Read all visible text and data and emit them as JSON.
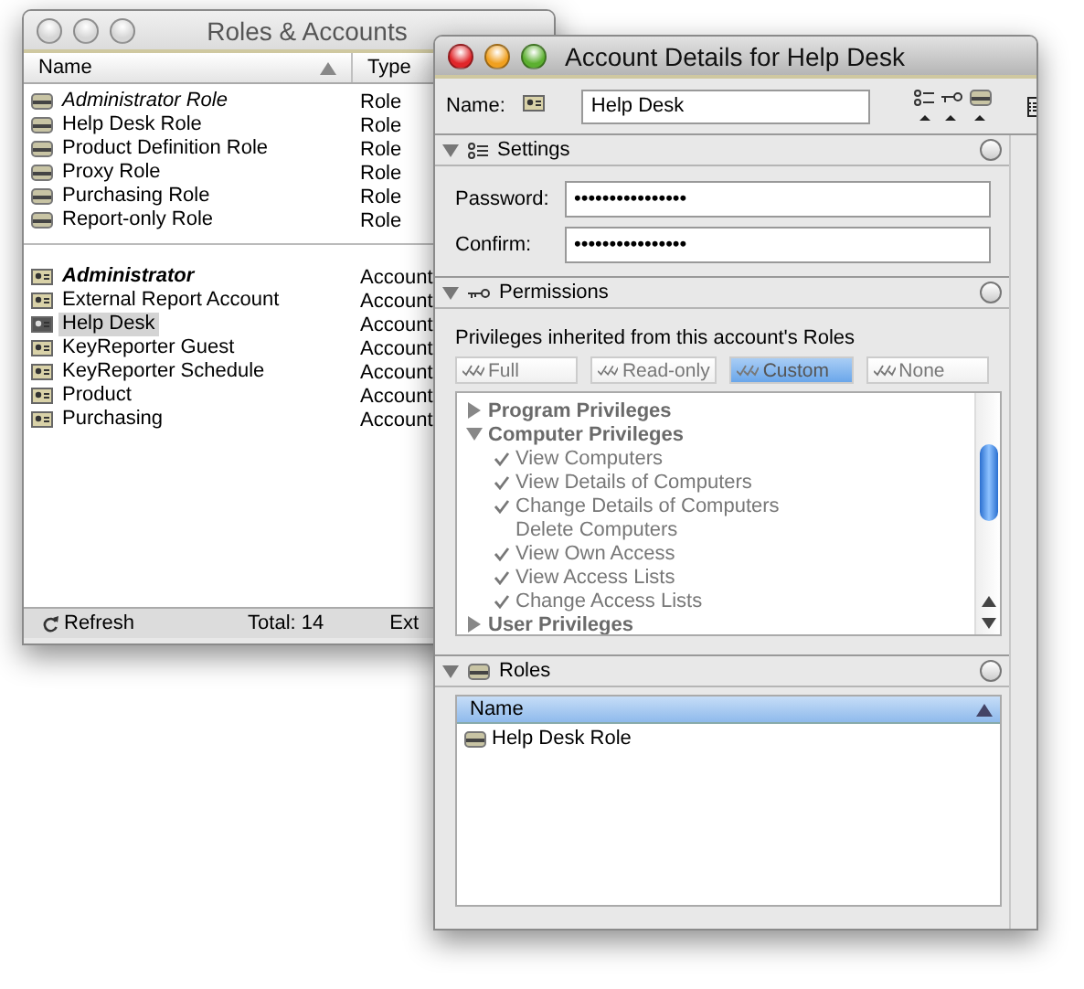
{
  "roles_window": {
    "title": "Roles & Accounts",
    "columns": [
      {
        "label": "Name",
        "sorted": true
      },
      {
        "label": "Type",
        "sorted": false
      }
    ],
    "groups": [
      [
        {
          "name": "Administrator Role",
          "type": "Role",
          "kind": "role",
          "italic": true,
          "bold": false,
          "selected": false
        },
        {
          "name": "Help Desk Role",
          "type": "Role",
          "kind": "role",
          "italic": false,
          "bold": false,
          "selected": false
        },
        {
          "name": "Product Definition Role",
          "type": "Role",
          "kind": "role",
          "italic": false,
          "bold": false,
          "selected": false
        },
        {
          "name": "Proxy Role",
          "type": "Role",
          "kind": "role",
          "italic": false,
          "bold": false,
          "selected": false
        },
        {
          "name": "Purchasing Role",
          "type": "Role",
          "kind": "role",
          "italic": false,
          "bold": false,
          "selected": false
        },
        {
          "name": "Report-only Role",
          "type": "Role",
          "kind": "role",
          "italic": false,
          "bold": false,
          "selected": false
        }
      ],
      [
        {
          "name": "Administrator",
          "type": "Account",
          "kind": "account",
          "italic": true,
          "bold": true,
          "selected": false
        },
        {
          "name": "External Report Account",
          "type": "Account",
          "kind": "account",
          "italic": false,
          "bold": false,
          "selected": false
        },
        {
          "name": "Help Desk",
          "type": "Account",
          "kind": "account",
          "italic": false,
          "bold": false,
          "selected": true
        },
        {
          "name": "KeyReporter Guest",
          "type": "Account",
          "kind": "account",
          "italic": false,
          "bold": false,
          "selected": false
        },
        {
          "name": "KeyReporter Schedule",
          "type": "Account",
          "kind": "account",
          "italic": false,
          "bold": false,
          "selected": false
        },
        {
          "name": "Product",
          "type": "Account",
          "kind": "account",
          "italic": false,
          "bold": false,
          "selected": false
        },
        {
          "name": "Purchasing",
          "type": "Account",
          "kind": "account",
          "italic": false,
          "bold": false,
          "selected": false
        }
      ]
    ],
    "status": {
      "refresh": "Refresh",
      "total": "Total: 14",
      "extra": "Ext"
    }
  },
  "details_window": {
    "title": "Account Details for Help Desk",
    "name_label": "Name:",
    "name_value": "Help Desk",
    "settings": {
      "title": "Settings",
      "expanded": true,
      "selected": false,
      "fields": [
        {
          "label": "Password:",
          "value": "••••••••••••••••"
        },
        {
          "label": "Confirm:",
          "value": "••••••••••••••••"
        }
      ]
    },
    "permissions": {
      "title": "Permissions",
      "expanded": true,
      "selected": false,
      "caption": "Privileges inherited from this account's Roles",
      "segments": [
        {
          "label": "Full",
          "selected": false
        },
        {
          "label": "Read-only",
          "selected": false
        },
        {
          "label": "Custom",
          "selected": true
        },
        {
          "label": "None",
          "selected": false
        }
      ],
      "tree": [
        {
          "label": "Program Privileges",
          "expanded": false
        },
        {
          "label": "Computer Privileges",
          "expanded": true,
          "children": [
            {
              "label": "View Computers",
              "checked": true
            },
            {
              "label": "View Details of Computers",
              "checked": true
            },
            {
              "label": "Change Details of Computers",
              "checked": true
            },
            {
              "label": "Delete Computers",
              "checked": false
            },
            {
              "label": "View Own Access",
              "checked": true
            },
            {
              "label": "View Access Lists",
              "checked": true
            },
            {
              "label": "Change Access Lists",
              "checked": true
            }
          ]
        },
        {
          "label": "User Privileges",
          "expanded": false
        }
      ]
    },
    "roles": {
      "title": "Roles",
      "expanded": true,
      "selected": false,
      "column": "Name",
      "rows": [
        "Help Desk Role"
      ]
    }
  }
}
